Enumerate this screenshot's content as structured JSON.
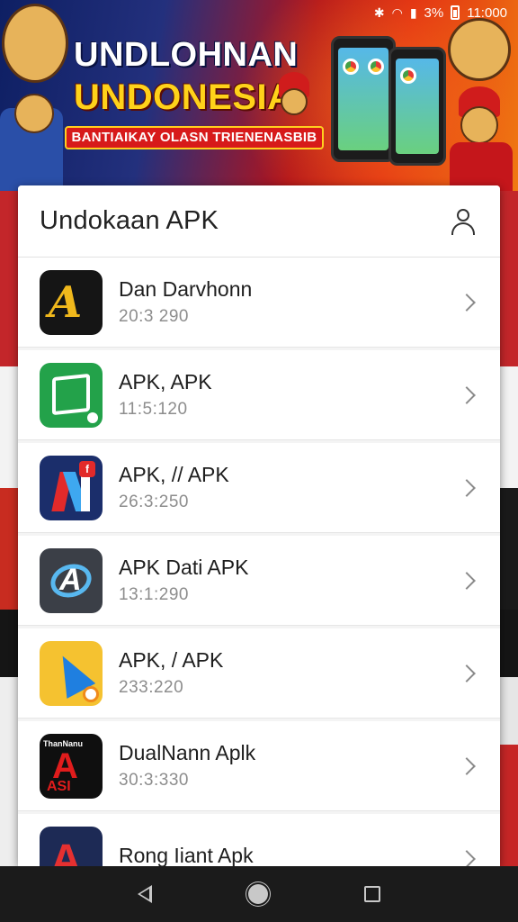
{
  "status_bar": {
    "icons": [
      "bluetooth-icon",
      "wifi-icon",
      "signal-icon"
    ],
    "battery": "3%",
    "time": "11:000"
  },
  "banner": {
    "title_line1": "UNDLOHNAN",
    "title_line2": "UNDONESIA",
    "ribbon": "BANTIAIKAY OLASN TRIENENASBIB"
  },
  "card": {
    "title": "Undokaan APK",
    "account_icon": "user-icon"
  },
  "apps": [
    {
      "name": "Dan Darvhonn",
      "meta": "20:3 290"
    },
    {
      "name": "APK, APK",
      "meta": "11:5:120"
    },
    {
      "name": "APK, // APK",
      "meta": "26:3:250"
    },
    {
      "name": "APK Dati APK",
      "meta": "13:1:290"
    },
    {
      "name": "APK, / APK",
      "meta": "233:220"
    },
    {
      "name": "DualNann Aplk",
      "meta": "30:3:330"
    },
    {
      "name": "Rong Iiant Apk",
      "meta": ""
    }
  ],
  "nav": {
    "back": "back-icon",
    "home": "home-icon",
    "recents": "recents-icon"
  },
  "colors": {
    "banner_blue": "#0e1f63",
    "banner_red": "#b3131b",
    "title_yellow": "#ffd21a",
    "card_bg": "#f4f4f4",
    "nav_bg": "#1b1b1b"
  }
}
